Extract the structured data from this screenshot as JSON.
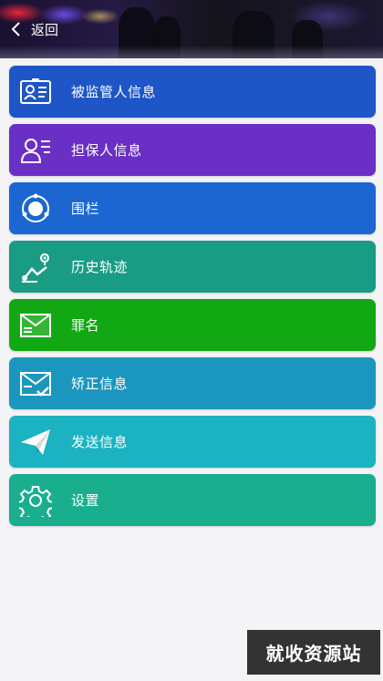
{
  "header": {
    "back_label": "返回"
  },
  "menu": {
    "items": [
      {
        "label": "被监管人信息",
        "icon": "id-card-icon",
        "color": "#1E55C7"
      },
      {
        "label": "担保人信息",
        "icon": "person-list-icon",
        "color": "#6A2FC5"
      },
      {
        "label": "围栏",
        "icon": "fence-circle-icon",
        "color": "#1C66D2"
      },
      {
        "label": "历史轨迹",
        "icon": "route-icon",
        "color": "#1A9C84"
      },
      {
        "label": "罪名",
        "icon": "envelope-list-icon",
        "color": "#12A814"
      },
      {
        "label": "矫正信息",
        "icon": "envelope-check-icon",
        "color": "#1B96BF"
      },
      {
        "label": "发送信息",
        "icon": "paper-plane-icon",
        "color": "#1BB3C2"
      },
      {
        "label": "设置",
        "icon": "gear-icon",
        "color": "#18AE8E"
      }
    ]
  },
  "watermark": {
    "text": "就收资源站"
  }
}
